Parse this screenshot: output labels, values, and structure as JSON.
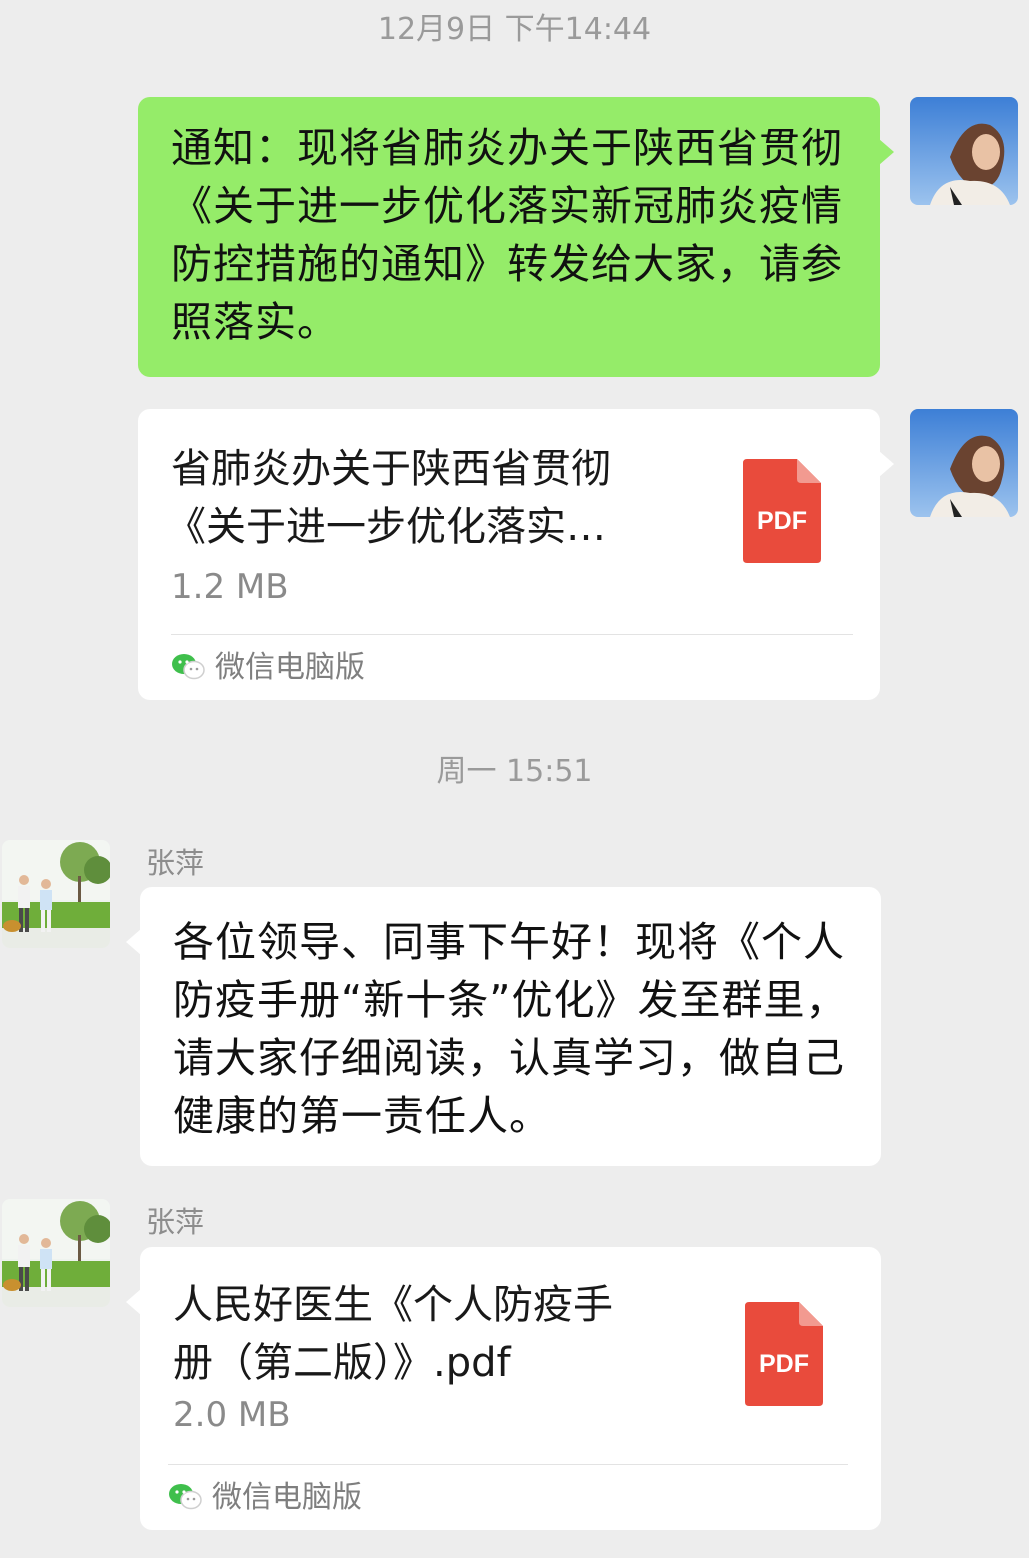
{
  "timestamps": [
    "12月9日 下午14:44",
    "周一 15:51"
  ],
  "messages": {
    "m1": {
      "text": "通知：现将省肺炎办关于陕西省贯彻《关于进一步优化落实新冠肺炎疫情防控措施的通知》转发给大家，请参照落实。"
    },
    "m2": {
      "file_name_line1": "省肺炎办关于陕西省贯彻",
      "file_name_line2": "《关于进一步优化落实…",
      "file_size": "1.2 MB",
      "file_type": "PDF",
      "source": "微信电脑版"
    },
    "m3": {
      "sender": "张萍",
      "text": "各位领导、同事下午好！现将《个人防疫手册“新十条”优化》发至群里，请大家仔细阅读，认真学习，做自己健康的第一责任人。"
    },
    "m4": {
      "sender": "张萍",
      "file_name_line1": "人民好医生《个人防疫手",
      "file_name_line2": "册（第二版）》.pdf",
      "file_size": "2.0 MB",
      "file_type": "PDF",
      "source": "微信电脑版"
    }
  },
  "icons": {
    "pdf": "pdf-file-icon",
    "source": "wechat-icon",
    "self_avatar": "woman-portrait-avatar",
    "other_avatar": "couple-walking-avatar"
  },
  "colors": {
    "background": "#ededed",
    "self_bubble": "#95ec69",
    "other_bubble": "#ffffff",
    "pdf_red": "#e94b3c",
    "wechat_green": "#3fbf4c"
  }
}
